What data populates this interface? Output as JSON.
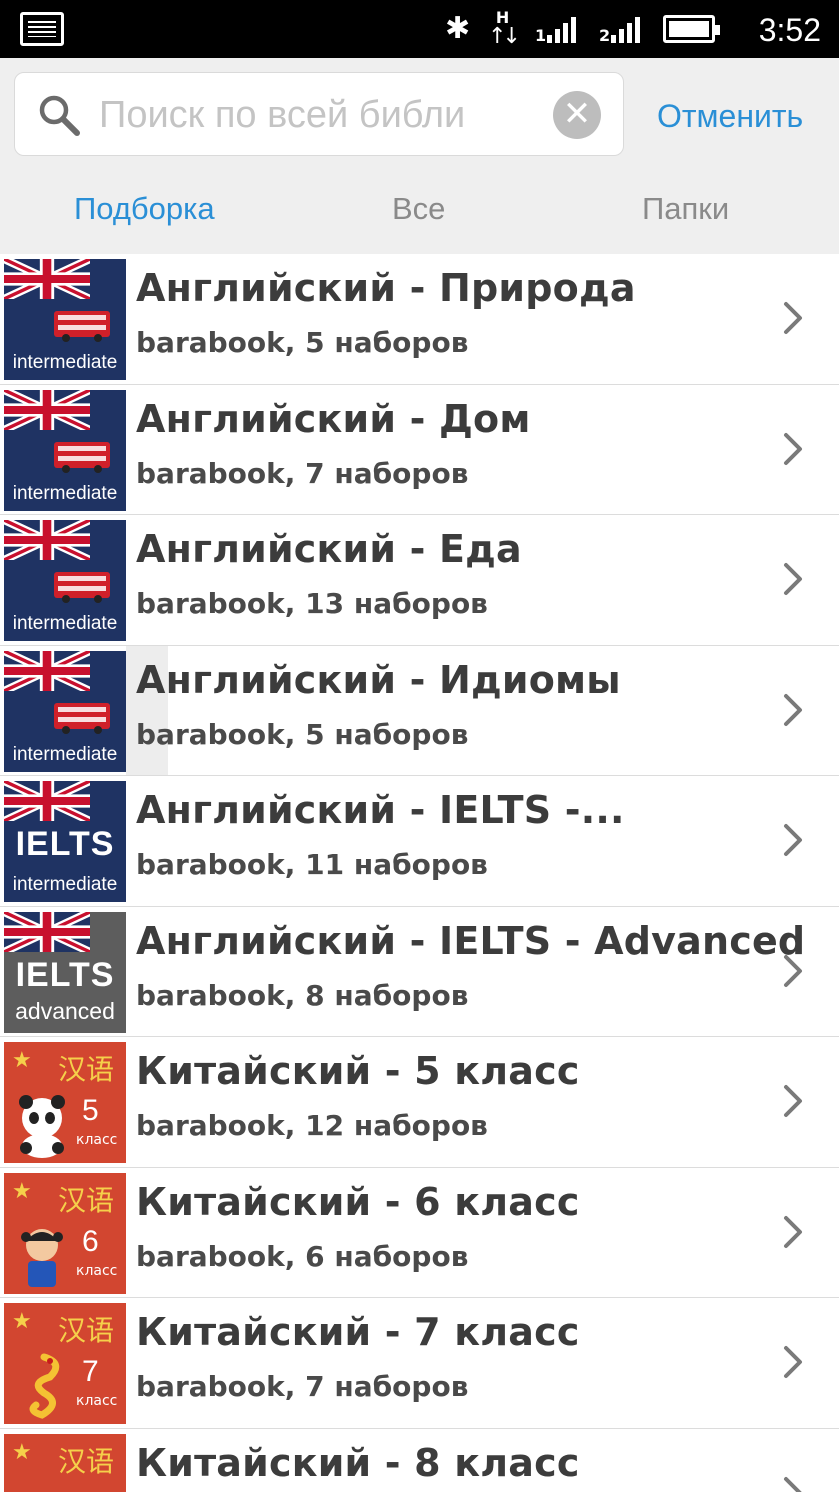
{
  "status_bar": {
    "time": "3:52",
    "bluetooth_icon": "bluetooth-icon",
    "data_label": "H",
    "sim1": "1",
    "sim2": "2"
  },
  "search": {
    "placeholder": "Поиск по всей библи",
    "value": "",
    "cancel_label": "Отменить"
  },
  "tabs": [
    {
      "label": "Подборка",
      "active": true
    },
    {
      "label": "Все",
      "active": false
    },
    {
      "label": "Папки",
      "active": false
    }
  ],
  "colors": {
    "accent": "#2a8fd6",
    "uk_thumb": "#1f3363",
    "cn_thumb": "#d24630"
  },
  "items": [
    {
      "title": "Английский - Природа",
      "subtitle": "barabook, 5 наборов",
      "thumb": {
        "type": "uk-bus",
        "level": "intermediate"
      }
    },
    {
      "title": "Английский - Дом",
      "subtitle": "barabook, 7 наборов",
      "thumb": {
        "type": "uk-bus",
        "level": "intermediate"
      }
    },
    {
      "title": "Английский - Еда",
      "subtitle": "barabook, 13 наборов",
      "thumb": {
        "type": "uk-bus",
        "level": "intermediate"
      }
    },
    {
      "title": "Английский - Идиомы",
      "subtitle": "barabook, 5 наборов",
      "thumb": {
        "type": "uk-bus",
        "level": "intermediate"
      }
    },
    {
      "title": "Английский - IELTS -...",
      "subtitle": "barabook, 11 наборов",
      "thumb": {
        "type": "uk-ielts",
        "big": "IELTS",
        "level": "intermediate"
      }
    },
    {
      "title": "Английский - IELTS - Advanced",
      "subtitle": "barabook, 8 наборов",
      "thumb": {
        "type": "uk-ielts-adv",
        "big": "IELTS",
        "level": "advanced"
      }
    },
    {
      "title": "Китайский - 5 класс",
      "subtitle": "barabook, 12 наборов",
      "thumb": {
        "type": "cn",
        "chars": "汉语",
        "num": "5",
        "class": "класс"
      }
    },
    {
      "title": "Китайский - 6 класс",
      "subtitle": "barabook, 6 наборов",
      "thumb": {
        "type": "cn",
        "chars": "汉语",
        "num": "6",
        "class": "класс"
      }
    },
    {
      "title": "Китайский - 7 класс",
      "subtitle": "barabook, 7 наборов",
      "thumb": {
        "type": "cn",
        "chars": "汉语",
        "num": "7",
        "class": "класс"
      }
    },
    {
      "title": "Китайский - 8 класс",
      "subtitle": "",
      "thumb": {
        "type": "cn",
        "chars": "汉语",
        "num": "",
        "class": ""
      }
    }
  ]
}
